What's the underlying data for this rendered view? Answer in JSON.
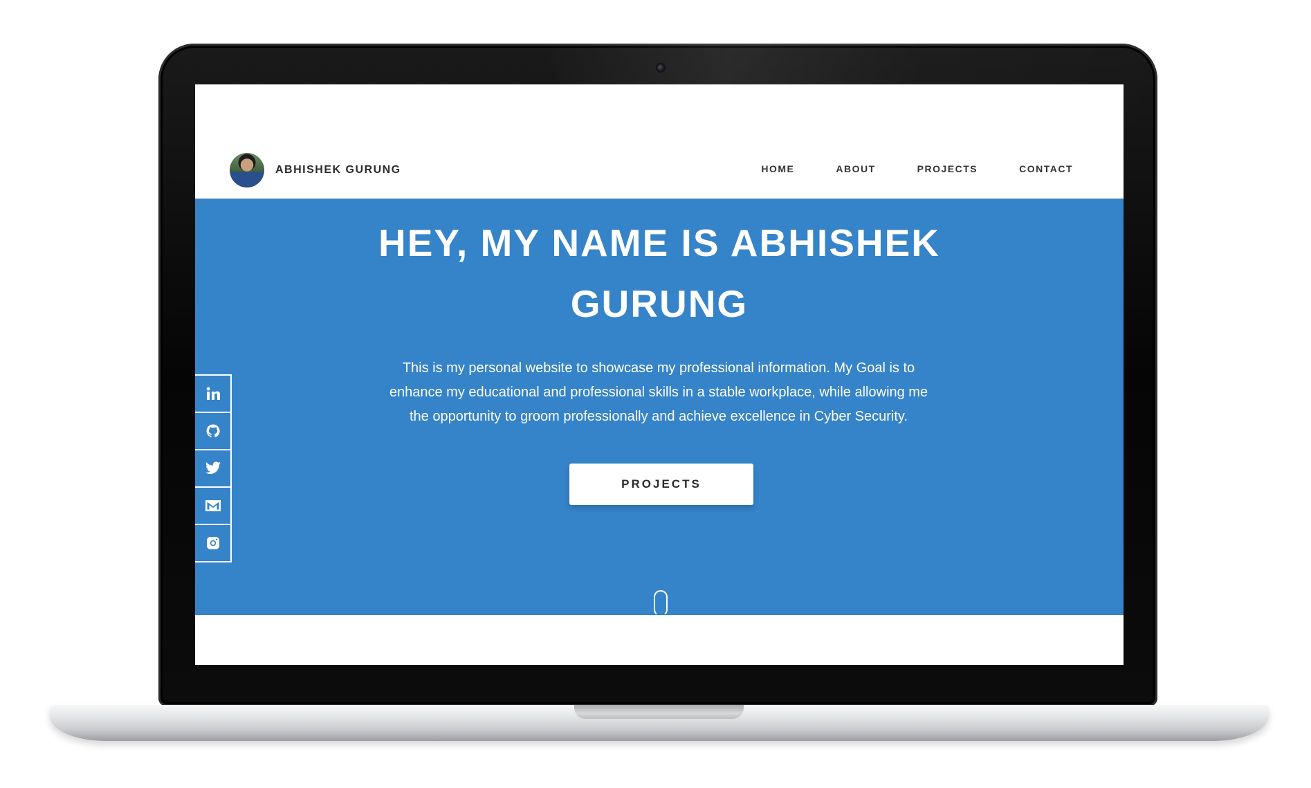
{
  "nav": {
    "brand_name": "ABHISHEK GURUNG",
    "links": [
      {
        "label": "HOME"
      },
      {
        "label": "ABOUT"
      },
      {
        "label": "PROJECTS"
      },
      {
        "label": "CONTACT"
      }
    ]
  },
  "hero": {
    "title_line1": "HEY, MY NAME IS ABHISHEK",
    "title_line2": "GURUNG",
    "description": "This is my personal website to showcase my professional information. My Goal is to enhance my educational and professional skills in a stable workplace, while allowing me the opportunity to groom professionally and achieve excellence in Cyber Security.",
    "button_label": "PROJECTS",
    "background_color": "#3583c9"
  },
  "social": [
    {
      "icon": "linkedin-icon"
    },
    {
      "icon": "github-icon"
    },
    {
      "icon": "twitter-icon"
    },
    {
      "icon": "mail-icon"
    },
    {
      "icon": "instagram-icon"
    }
  ]
}
